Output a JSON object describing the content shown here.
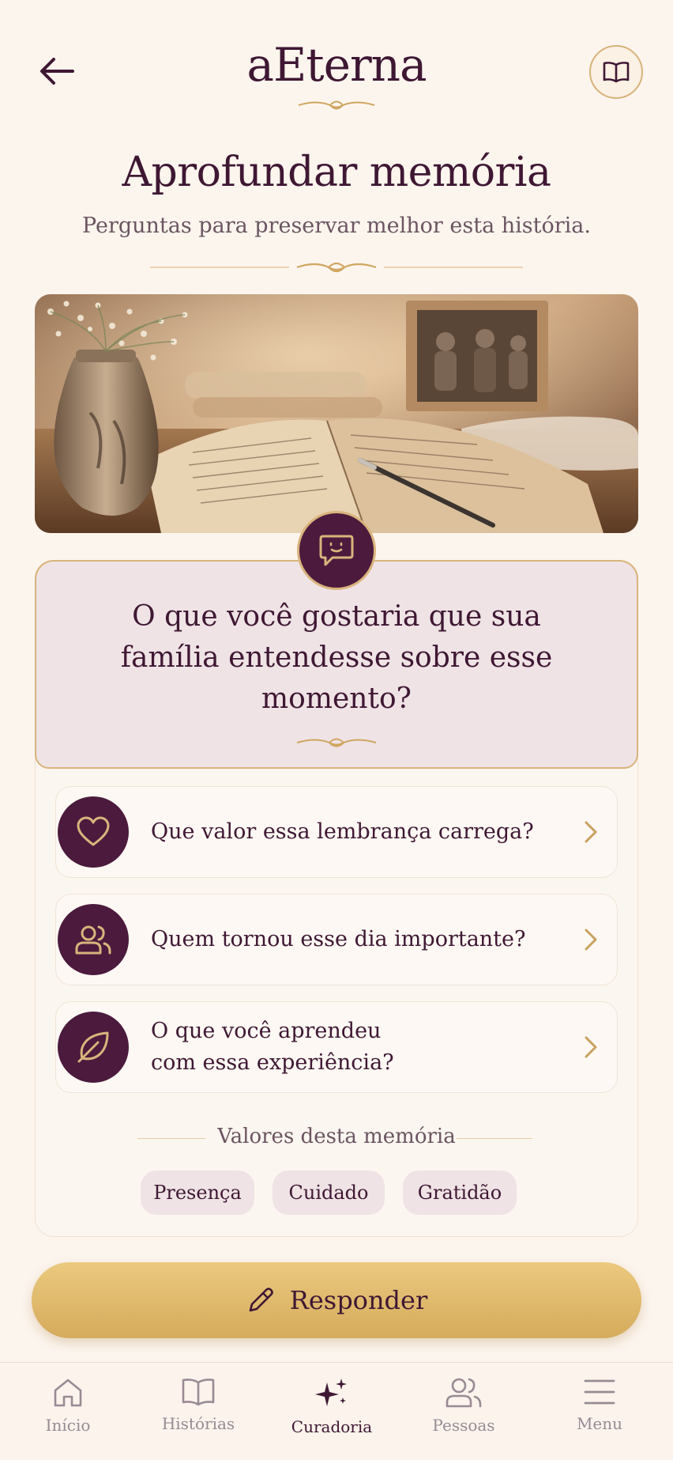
{
  "header": {
    "app_title": "aEterna"
  },
  "page": {
    "title": "Aprofundar memória",
    "subtitle": "Perguntas para preservar melhor esta história."
  },
  "question": {
    "text": "O que você gostaria que sua família entendesse sobre esse momento?"
  },
  "options": [
    {
      "label": "Que valor essa lembrança carrega?",
      "icon": "heart-icon"
    },
    {
      "label": "Quem tornou esse dia importante?",
      "icon": "people-icon"
    },
    {
      "label": "O que você aprendeu com essa experiência?",
      "icon": "leaf-icon"
    }
  ],
  "values": {
    "title": "Valores desta memória",
    "chips": [
      "Presença",
      "Cuidado",
      "Gratidão"
    ]
  },
  "respond_button": {
    "label": "Responder"
  },
  "tabs": [
    {
      "label": "Início",
      "icon": "home-icon",
      "active": false
    },
    {
      "label": "Histórias",
      "icon": "book-icon",
      "active": false
    },
    {
      "label": "Curadoria",
      "icon": "sparkle-icon",
      "active": true
    },
    {
      "label": "Pessoas",
      "icon": "people-icon",
      "active": false
    },
    {
      "label": "Menu",
      "icon": "menu-icon",
      "active": false
    }
  ],
  "colors": {
    "background": "#fcf5ee",
    "primary": "#4b1a3d",
    "gold": "#d9b47c",
    "question_bg": "#efe3e5"
  }
}
